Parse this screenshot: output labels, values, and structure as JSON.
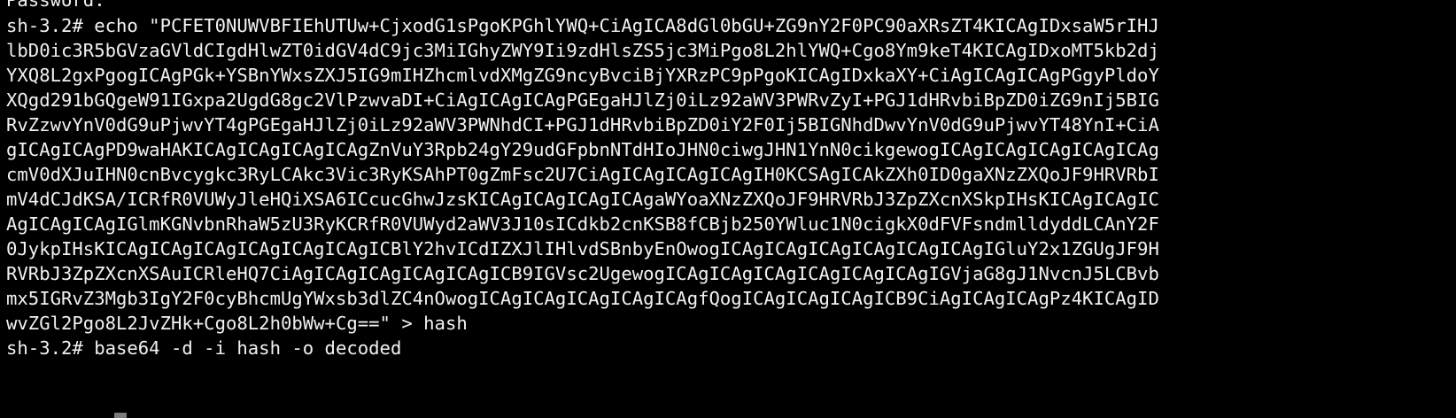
{
  "terminal": {
    "lines": [
      "Password:",
      "sh-3.2# echo \"PCFET0NUWVBFIEhUTUw+CjxodG1sPgoKPGhlYWQ+CiAgICA8dGl0bGU+ZG9nY2F0PC90aXRsZT4KICAgIDxsaW5rIHJ",
      "lbD0ic3R5bGVzaGVldCIgdHlwZT0idGV4dC9jc3MiIGhyZWY9Ii9zdHlsZS5jc3MiPgo8L2hlYWQ+Cgo8Ym9keT4KICAgIDxoMT5kb2dj",
      "YXQ8L2gxPgogICAgPGk+YSBnYWxsZXJ5IG9mIHZhcmlvdXMgZG9ncyBvciBjYXRzPC9pPgoKICAgIDxkaXY+CiAgICAgICAgPGgyPldoY",
      "XQgd291bGQgeW91IGxpa2UgdG8gc2VlPzwvaDI+CiAgICAgICAgPGEgaHJlZj0iLz92aWV3PWRvZyI+PGJ1dHRvbiBpZD0iZG9nIj5BIG",
      "RvZzwvYnV0dG9uPjwvYT4gPGEgaHJlZj0iLz92aWV3PWNhdCI+PGJ1dHRvbiBpZD0iY2F0Ij5BIGNhdDwvYnV0dG9uPjwvYT48YnI+CiA",
      "gICAgICAgPD9waHAKICAgICAgICAgICAgZnVuY3Rpb24gY29udGFpbnNTdHIoJHN0ciwgJHN1YnN0cikgewogICAgICAgICAgICAgICAg",
      "cmV0dXJuIHN0cnBvcygkc3RyLCAkc3Vic3RyKSAhPT0gZmFsc2U7CiAgICAgICAgICAgIH0KCSAgICAkZXh0ID0gaXNzZXQoJF9HRVRbI",
      "mV4dCJdKSA/ICRfR0VUWyJleHQiXSA6ICcucGhwJzsKICAgICAgICAgICAgaWYoaXNzZXQoJF9HRVRbJ3ZpZXcnXSkpIHsKICAgICAgIC",
      "AgICAgICAgIGlmKGNvbnRhaW5zU3RyKCRfR0VUWyd2aWV3J10sICdkb2cnKSB8fCBjb250YWluc1N0cigkX0dFVFsndmlldyddLCAnY2F",
      "0JykpIHsKICAgICAgICAgICAgICAgICAgICBlY2hvICdIZXJlIHlvdSBnbyEnOwogICAgICAgICAgICAgICAgICAgIGluY2x1ZGUgJF9H",
      "RVRbJ3ZpZXcnXSAuICRleHQ7CiAgICAgICAgICAgICAgICB9IGVsc2UgewogICAgICAgICAgICAgICAgICAgIGVjaG8gJ1NvcnJ5LCBvb",
      "mx5IGRvZ3Mgb3IgY2F0cyBhcmUgYWxsb3dlZC4nOwogICAgICAgICAgICAgICAgfQogICAgICAgICAgICB9CiAgICAgICAgPz4KICAgID",
      "wvZGl2Pgo8L2JvZHk+Cgo8L2h0bWw+Cg==\" > hash",
      "sh-3.2# base64 -d -i hash -o decoded"
    ]
  },
  "colors": {
    "background": "#000000",
    "text": "#f2f2f2",
    "cursor": "#7a7a7a"
  }
}
